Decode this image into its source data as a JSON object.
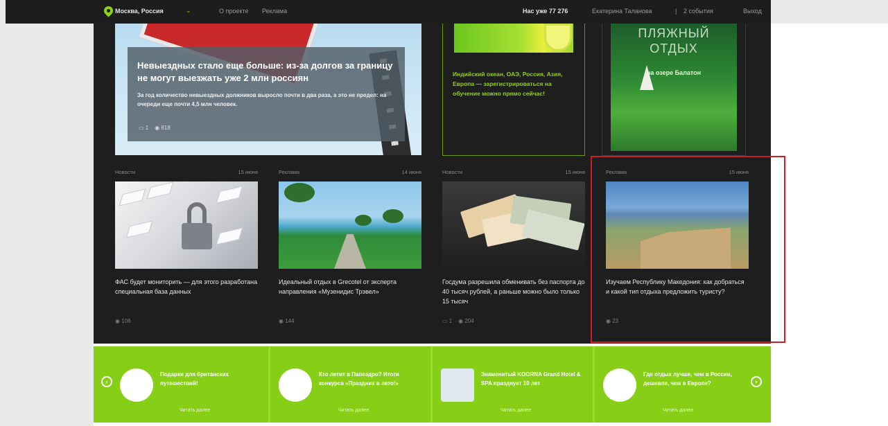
{
  "topbar": {
    "city": "Москва, Россия",
    "links": [
      "О проекте",
      "Реклама"
    ],
    "members": "Нас уже 77 276",
    "user": "Екатерина Таланова",
    "divider": "|",
    "events": "2 события",
    "logout": "Выход"
  },
  "hero": {
    "title": "Невыездных стало еще больше: из-за долгов за границу не могут выезжать уже 2 млн россиян",
    "subtitle": "За год количество невыездных должников выросло почти в два раза, а это не предел: на очереди еще почти 4,5 млн человек.",
    "comments": "1",
    "views": "818"
  },
  "promos": {
    "ocean": "Индийский океан, ОАЭ, Россия, Азия, Европа — зарегистрироваться на обучение можно прямо сейчас!",
    "beach_line1": "ПЛЯЖНЫЙ",
    "beach_line2": "ОТДЫХ",
    "beach_small": "на озере Балатон"
  },
  "cards": [
    {
      "category": "Новости",
      "date": "15 июня",
      "title": "ФАС будет мониторить — для этого разработана специальная база данных",
      "comments": "",
      "views": "106"
    },
    {
      "category": "Реклама",
      "date": "14 июня",
      "title": "Идеальный отдых в Grecotel от эксперта направления «Музенидис Трэвел»",
      "comments": "",
      "views": "144"
    },
    {
      "category": "Новости",
      "date": "15 июня",
      "title": "Госдума разрешила обменивать без паспорта до 40 тысяч рублей, а раньше можно было только 15 тысяч",
      "comments": "1",
      "views": "204"
    },
    {
      "category": "Реклама",
      "date": "15 июня",
      "title": "Изучаем Республику Македония: как добраться и какой тип отдыха предложить туристу?",
      "comments": "",
      "views": "23"
    }
  ],
  "carousel": {
    "prev": "‹",
    "next": "›",
    "items": [
      {
        "text": "Подарки для британских путешествий!",
        "more": "Читать далее"
      },
      {
        "text": "Кто летит в Папеэдро? Итоги конкурса «Праздник в лето!»",
        "more": "Читать далее"
      },
      {
        "text": "Знаменитый KOORNA Grand Hotel & SPA празднует 10 лет",
        "more": "Читать далее"
      },
      {
        "text": "Где отдых лучше, чем в России, дешевле, чем в Европе?",
        "more": "Читать далее"
      }
    ]
  },
  "colors": {
    "accent": "#86cf16",
    "dark": "#1e1e1e",
    "highlight": "#d01b28"
  }
}
